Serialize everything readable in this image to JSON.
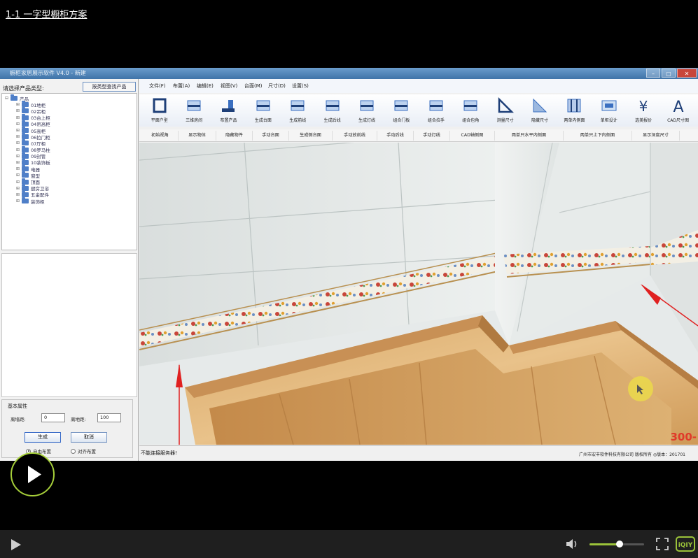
{
  "video": {
    "title": "1-1 一字型橱柜方案",
    "progress_fraction": 0.0,
    "volume_fraction": 0.55,
    "brand": "iQIYI"
  },
  "app": {
    "window_title": "橱柜家居展示软件 V4.0 - 新建",
    "menus": [
      "文件(F)",
      "布置(A)",
      "编辑(E)",
      "视图(V)",
      "台面(M)",
      "尺寸(D)",
      "设置(S)"
    ],
    "tools": [
      {
        "label": "平面户型",
        "icon": "floorplan-icon"
      },
      {
        "label": "三维房间",
        "icon": "3d-room-icon"
      },
      {
        "label": "布置产品",
        "icon": "place-product-icon"
      },
      {
        "label": "生成台面",
        "icon": "countertop-icon"
      },
      {
        "label": "生成前线",
        "icon": "front-line-icon"
      },
      {
        "label": "生成后线",
        "icon": "back-line-icon"
      },
      {
        "label": "生成灯线",
        "icon": "light-line-icon"
      },
      {
        "label": "组合门板",
        "icon": "door-panel-icon"
      },
      {
        "label": "组合拉手",
        "icon": "handle-icon"
      },
      {
        "label": "组合包角",
        "icon": "corner-icon"
      },
      {
        "label": "测量尺寸",
        "icon": "ruler-icon"
      },
      {
        "label": "隐藏尺寸",
        "icon": "hide-dimension-icon"
      },
      {
        "label": "两单内侧面",
        "icon": "inner-side-icon"
      },
      {
        "label": "单柜设计",
        "icon": "cabinet-design-icon"
      },
      {
        "label": "选美报价",
        "icon": "quote-icon"
      },
      {
        "label": "CAD尺寸图",
        "icon": "cad-text-icon"
      }
    ],
    "toolbar2": [
      "初始视角",
      "显示物体",
      "隐藏物件",
      "手动台面",
      "生成侧台面",
      "手动放前线",
      "手动后线",
      "手动灯线",
      "CAD轴侧图",
      "两单只水平内侧面",
      "两单只上下内侧面",
      "显示深度尺寸"
    ],
    "sidebar": {
      "label": "请选择产品类型:",
      "search_button": "按类型查找产品",
      "tree_root": "产品",
      "tree_items": [
        "01地柜",
        "02吊柜",
        "03台上柜",
        "04吊高柜",
        "05高柜",
        "06拉门柜",
        "07厅柜",
        "08罗马柱",
        "09封管",
        "10装饰板",
        "电器",
        "窗型",
        "顶面",
        "厨房卫浴",
        "五金配件",
        "装饰柜"
      ]
    },
    "props": {
      "title": "基本属性",
      "field1_label": "离墙距:",
      "field1_value": "0",
      "field2_label": "离地距:",
      "field2_value": "100",
      "generate_button": "生成",
      "cancel_button": "取消",
      "radio_auto": "自由布置",
      "radio_snap": "对齐布置",
      "radio_selected": "auto"
    },
    "status": {
      "left": "不能连接服务器!",
      "right": "广州市宏丰软件科技有限公司 版权所有   ◎版本：201701"
    },
    "watermark": "300-"
  }
}
